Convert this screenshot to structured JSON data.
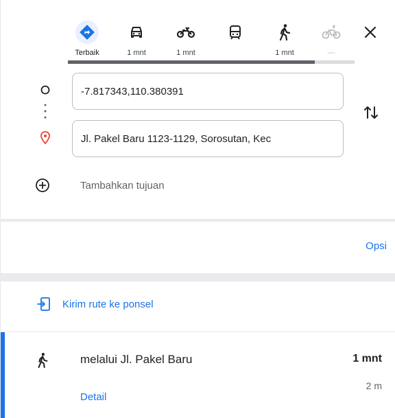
{
  "travel_modes": [
    {
      "name": "best",
      "label": "Terbaik",
      "icon": "directions-icon",
      "active": true
    },
    {
      "name": "car",
      "label": "1 mnt",
      "icon": "car-icon",
      "active": false
    },
    {
      "name": "motorcycle",
      "label": "1 mnt",
      "icon": "motorcycle-icon",
      "active": false
    },
    {
      "name": "transit",
      "label": "",
      "icon": "train-icon",
      "active": false
    },
    {
      "name": "walk",
      "label": "1 mnt",
      "icon": "walk-icon",
      "active": false
    },
    {
      "name": "bicycle",
      "label": "—",
      "icon": "bicycle-icon",
      "active": false
    }
  ],
  "origin": {
    "value": "-7.817343,110.380391"
  },
  "destination": {
    "value": "Jl. Pakel Baru 1123-1129, Sorosutan, Kec"
  },
  "add_destination": "Tambahkan tujuan",
  "options_label": "Opsi",
  "send_to_phone": "Kirim rute ke ponsel",
  "route": {
    "via": "melalui Jl. Pakel Baru",
    "duration": "1 mnt",
    "distance": "2 m",
    "detail_label": "Detail"
  },
  "colors": {
    "accent": "#1a73e8",
    "destination_pin": "#ea4335"
  }
}
